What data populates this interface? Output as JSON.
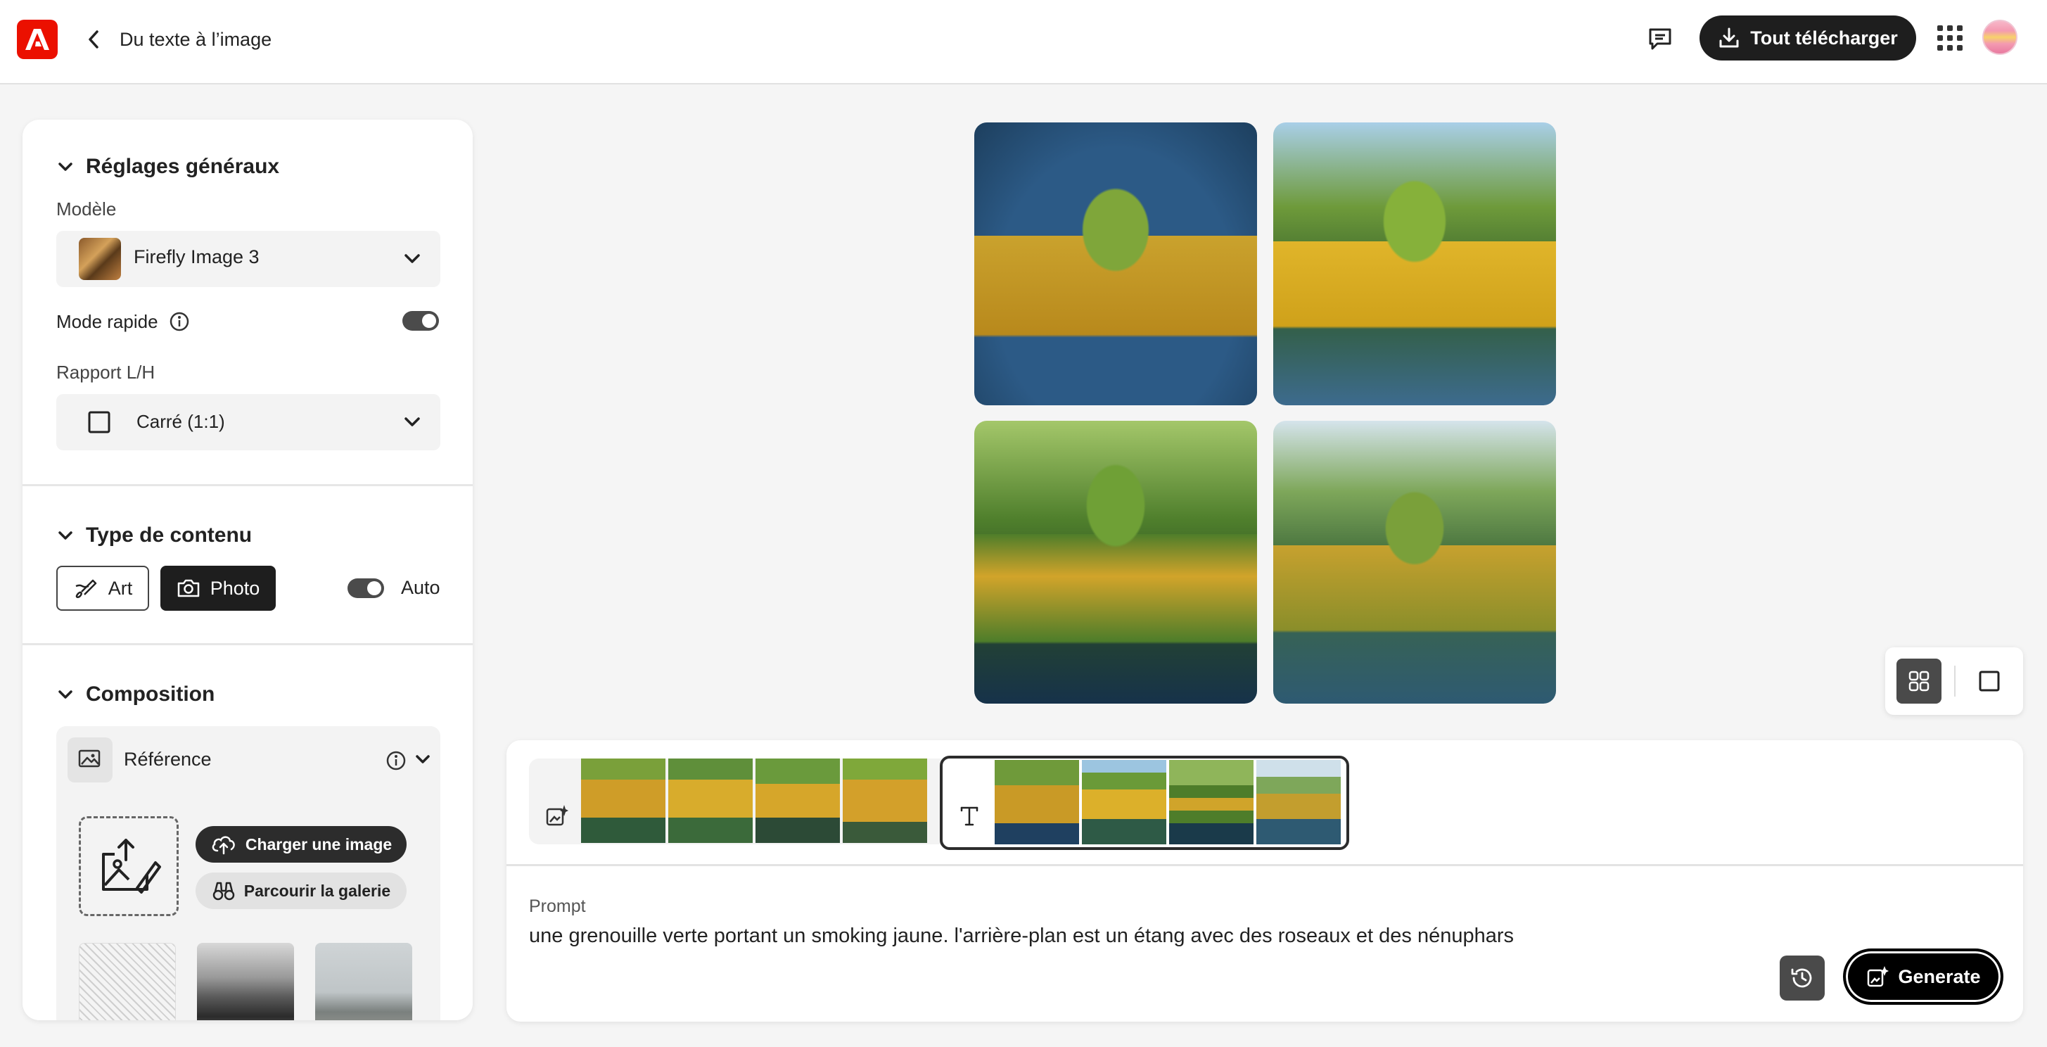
{
  "header": {
    "app_logo": "adobe-firefly-logo",
    "back_icon": "chevron-left-icon",
    "title": "Du texte à l’image",
    "download_all_label": "Tout télécharger"
  },
  "sidebar": {
    "general": {
      "title": "Réglages généraux",
      "model_label": "Modèle",
      "model_value": "Firefly Image 3",
      "fast_mode_label": "Mode rapide",
      "fast_mode_on": true,
      "aspect_label": "Rapport L/H",
      "aspect_value": "Carré (1:1)"
    },
    "content_type": {
      "title": "Type de contenu",
      "art_label": "Art",
      "photo_label": "Photo",
      "selected": "Photo",
      "auto_label": "Auto",
      "auto_on": true
    },
    "composition": {
      "title": "Composition",
      "reference_label": "Référence",
      "upload_label": "Charger une image",
      "browse_label": "Parcourir la galerie"
    }
  },
  "gallery": {
    "images": [
      "frog-yellow-tuxedo-1",
      "frog-yellow-tuxedo-2",
      "frog-yellow-tuxedo-3",
      "frog-yellow-tuxedo-4"
    ],
    "view_mode": "grid"
  },
  "prompt_panel": {
    "label": "Prompt",
    "text": "une grenouille verte portant un smoking jaune. l'arrière-plan est un étang avec des roseaux et des nénuphars",
    "generate_label": "Generate"
  },
  "colors": {
    "brand": "#eb1000",
    "dark_button": "#1e1e1e",
    "panel_bg": "#f3f3f3"
  }
}
